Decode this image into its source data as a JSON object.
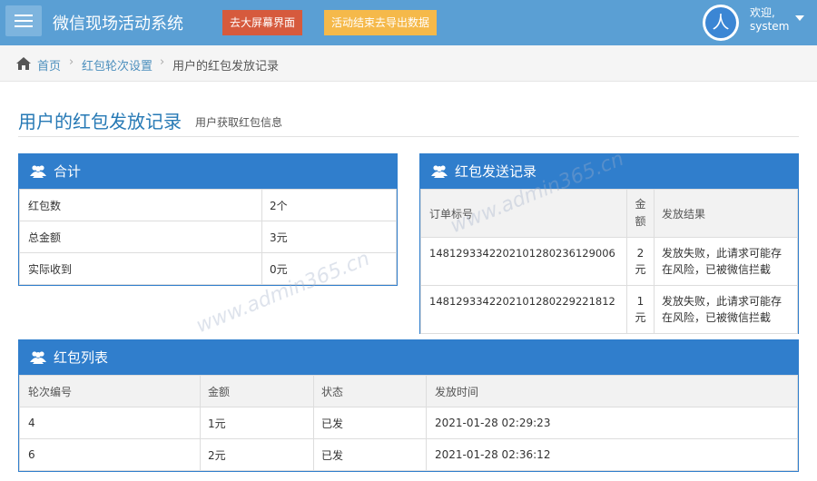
{
  "navbar": {
    "brand": "微信现场活动系统",
    "big_screen_button": "去大屏幕界面",
    "export_button": "活动结束去导出数据",
    "user": {
      "avatar_text": "人",
      "greeting": "欢迎,",
      "name": "system"
    }
  },
  "breadcrumb": {
    "home": "首页",
    "item1": "红包轮次设置",
    "item2": "用户的红包发放记录"
  },
  "page": {
    "title": "用户的红包发放记录",
    "subtitle": "用户获取红包信息"
  },
  "summary": {
    "title": "合计",
    "rows": [
      {
        "label": "红包数",
        "value": "2个"
      },
      {
        "label": "总金额",
        "value": "3元"
      },
      {
        "label": "实际收到",
        "value": "0元"
      }
    ]
  },
  "send_records": {
    "title": "红包发送记录",
    "headers": {
      "order": "订单标号",
      "amount_line1": "金",
      "amount_line2": "额",
      "result": "发放结果"
    },
    "rows": [
      {
        "order": "14812933422021012802361290 06",
        "order_display": "1481293342202101280236129006",
        "amount_line1": "2",
        "amount_line2": "元",
        "result_line1": "发放失败，此请求可能存",
        "result_line2": "在风险，已被微信拦截"
      },
      {
        "order": "1481293342202101280229221812",
        "order_display": "1481293342202101280229221812",
        "amount_line1": "1",
        "amount_line2": "元",
        "result_line1": "发放失败，此请求可能存",
        "result_line2": "在风险，已被微信拦截"
      }
    ]
  },
  "rounds": {
    "title": "红包列表",
    "headers": {
      "round": "轮次编号",
      "amount": "金额",
      "status": "状态",
      "time": "发放时间"
    },
    "rows": [
      {
        "round": "4",
        "amount": "1元",
        "status": "已发",
        "time": "2021-01-28 02:29:23"
      },
      {
        "round": "6",
        "amount": "2元",
        "status": "已发",
        "time": "2021-01-28 02:36:12"
      }
    ]
  },
  "watermark": "www.admin365.cn",
  "colors": {
    "navbar": "#5a9fd4",
    "widget_header": "#307ecc",
    "title": "#2679b5",
    "danger": "#d65a3d",
    "warning": "#f5b94a"
  }
}
